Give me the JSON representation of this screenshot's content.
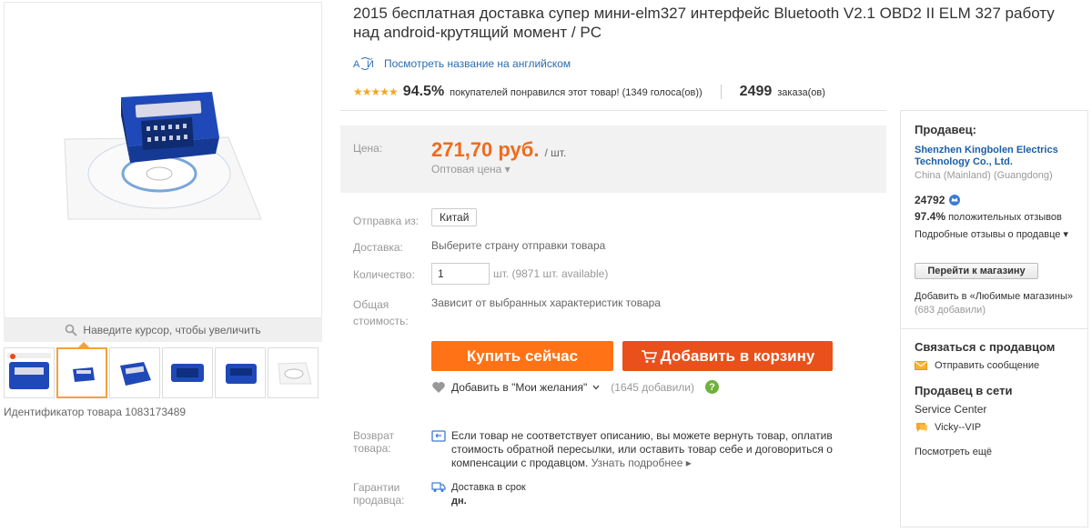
{
  "product": {
    "title": "2015 бесплатная доставка супер мини-elm327 интерфейс Bluetooth V2.1 OBD2 II ELM 327 работу над android-крутящий момент / PC",
    "translate_link": "Посмотреть название на английском",
    "rating_pct": "94.5%",
    "rating_text": "покупателей понравился этот товар! (1349 голоса(ов))",
    "orders_count": "2499",
    "orders_label": "заказа(ов)",
    "stars": "★★★★★",
    "id_text": "Идентификатор товара 1083173489"
  },
  "gallery": {
    "zoom_hint": "Наведите курсор, чтобы увеличить",
    "thumb_count": 6,
    "active_thumb": 2
  },
  "price": {
    "label": "Цена:",
    "value": "271,70 руб.",
    "unit": "/ шт.",
    "wholesale": "Оптовая цена ▾"
  },
  "shipping": {
    "from_label": "Отправка из:",
    "from_value": "Китай",
    "delivery_label": "Доставка:",
    "delivery_value": "Выберите страну отправки товара",
    "qty_label": "Количество:",
    "qty_value": "1",
    "qty_after": "шт. (9871 шт. available)",
    "total_label": "Общая стоимость:",
    "total_value": "Зависит от выбранных характеристик товара"
  },
  "actions": {
    "buy_now": "Купить сейчас",
    "add_to_cart": "Добавить в корзину",
    "wishlist": "Добавить в \"Мои желания\"",
    "wishlist_count": "(1645 добавили)"
  },
  "protection": {
    "return_label": "Возврат товара:",
    "return_text": "Если товар не соответствует описанию, вы можете вернуть товар, оплатив стоимость обратной пересылки, или оставить товар себе и договориться о компенсации с продавцом.",
    "return_link": "Узнать подробнее ▸",
    "guarantee_label": "Гарантии продавца:",
    "guarantee_text": "Доставка в срок",
    "guarantee_unit": "дн."
  },
  "seller": {
    "heading": "Продавец:",
    "name": "Shenzhen Kingbolen Electrics Technology Co., Ltd.",
    "location": "China (Mainland) (Guangdong)",
    "score": "24792",
    "positive_pct": "97.4%",
    "positive_label": "положительных отзывов",
    "detailed_reviews": "Подробные отзывы о продавце ▾",
    "go_store": "Перейти к магазину",
    "fav_text": "Добавить в «Любимые магазины»",
    "fav_count": "(683 добавили)",
    "contact_heading": "Связаться с продавцом",
    "send_message": "Отправить сообщение",
    "online_heading": "Продавец в сети",
    "service_center": "Service Center",
    "vip_name": "Vicky--VIP",
    "see_more": "Посмотреть ещё"
  },
  "colors": {
    "accent": "#ff7215",
    "cart": "#e9501b",
    "price": "#f26a1b",
    "link": "#1a5fa8",
    "star": "#f5a623"
  }
}
